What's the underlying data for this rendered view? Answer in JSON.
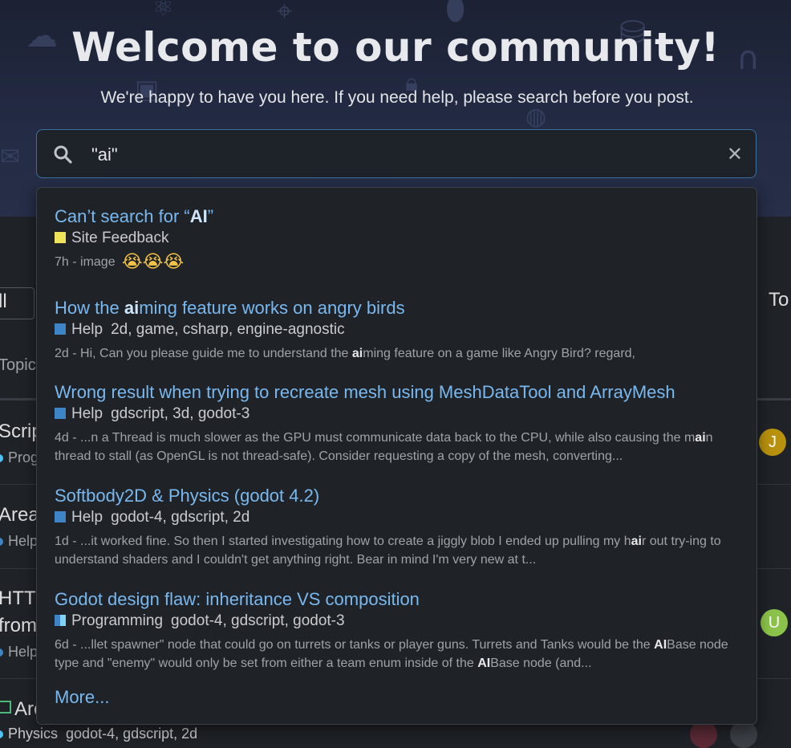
{
  "hero": {
    "title": "Welcome to our community!",
    "subtitle": "We're happy to have you here. If you need help, please search before you post."
  },
  "search": {
    "query": "\"ai\"",
    "icon": "search-icon",
    "clear_icon": "close-icon",
    "clear_glyph": "✕"
  },
  "background_list": {
    "category_dropdown_label": "ll cat",
    "top_label": "To",
    "column_header": "Topic",
    "rows": [
      {
        "title": "Scrip",
        "category": "Prog",
        "category_color": "#4fc3f7",
        "avatar_letter": "J",
        "avatar_color": "#b8910d"
      },
      {
        "title": "Area",
        "category": "Help",
        "category_color": "#3d85c6"
      },
      {
        "title": "HTTI",
        "title2": "from",
        "category": "Help",
        "category_color": "#3d85c6",
        "avatar_letter": "U",
        "avatar_color": "#8bc34a"
      },
      {
        "title": "Are",
        "category": "Physics",
        "category_color": "#4fc3f7",
        "tags": "godot-4, gdscript, 2d"
      }
    ]
  },
  "results": [
    {
      "title_parts": [
        "Can’t search for “",
        "AI",
        "”"
      ],
      "category": "Site Feedback",
      "category_color": "#f0e35c",
      "tags": "",
      "age": "7h",
      "excerpt_parts": [
        "image "
      ],
      "emoji": "😭😭😭"
    },
    {
      "title_parts": [
        "How the ",
        "ai",
        "ming feature works on angry birds"
      ],
      "category": "Help",
      "category_color": "#3d85c6",
      "tags": "2d, game, csharp, engine-agnostic",
      "age": "2d",
      "excerpt_parts": [
        "Hi, Can you please guide me to understand the ",
        "ai",
        "ming feature on a game like Angry Bird? regard,"
      ]
    },
    {
      "title_parts": [
        "Wrong result when trying to recreate mesh using MeshDataTool and ArrayMesh"
      ],
      "category": "Help",
      "category_color": "#3d85c6",
      "tags": "gdscript, 3d, godot-3",
      "age": "4d",
      "excerpt_parts": [
        "...n a Thread is much slower as the GPU must communicate data back to the CPU, while also causing the m",
        "ai",
        "n thread to stall (as OpenGL is not thread-safe). Consider requesting a copy of the mesh, converting..."
      ]
    },
    {
      "title_parts": [
        "Softbody2D & Physics (godot 4.2)"
      ],
      "category": "Help",
      "category_color": "#3d85c6",
      "tags": "godot-4, gdscript, 2d",
      "age": "1d",
      "excerpt_parts": [
        "...it worked fine. So then I started investigating how to create a jiggly blob I ended up pulling my h",
        "ai",
        "r out try-ing to understand shaders and I couldn't get anything right. Bear in mind I'm very new at t..."
      ]
    },
    {
      "title_parts": [
        "Godot design flaw: inheritance VS composition"
      ],
      "category": "Programming",
      "category_color": "#3d85c6",
      "category_color2": "#7fd4f5",
      "tags": "godot-4, gdscript, godot-3",
      "age": "6d",
      "excerpt_parts": [
        "...llet spawner\" node that could go on turrets or tanks or player guns. Turrets and Tanks would be the ",
        "AI",
        "Base node type and \"enemy\" would only be set from either a team enum inside of the ",
        "AI",
        "Base node (and..."
      ]
    }
  ],
  "more_label": "More...",
  "separator": " - "
}
